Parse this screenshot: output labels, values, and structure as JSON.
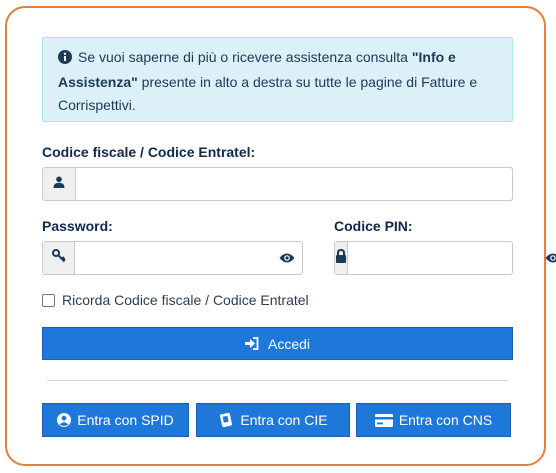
{
  "info": {
    "text_before": "Se vuoi saperne di più o ricevere assistenza consulta ",
    "bold": "\"Info e Assistenza\"",
    "text_after": " presente in alto a destra su tutte le pagine di Fatture e Corrispettivi."
  },
  "form": {
    "codice_label": "Codice fiscale / Codice Entratel:",
    "codice_value": "",
    "password_label": "Password:",
    "password_value": "",
    "pin_label": "Codice PIN:",
    "pin_value": "",
    "remember_label": "Ricorda Codice fiscale / Codice Entratel",
    "login_button": "Accedi"
  },
  "alt_login": {
    "spid": "Entra con SPID",
    "cie": "Entra con CIE",
    "cns": "Entra con CNS"
  },
  "colors": {
    "accent_border": "#e67f3c",
    "primary": "#1e78d9",
    "info_bg": "#dcf0f7"
  }
}
